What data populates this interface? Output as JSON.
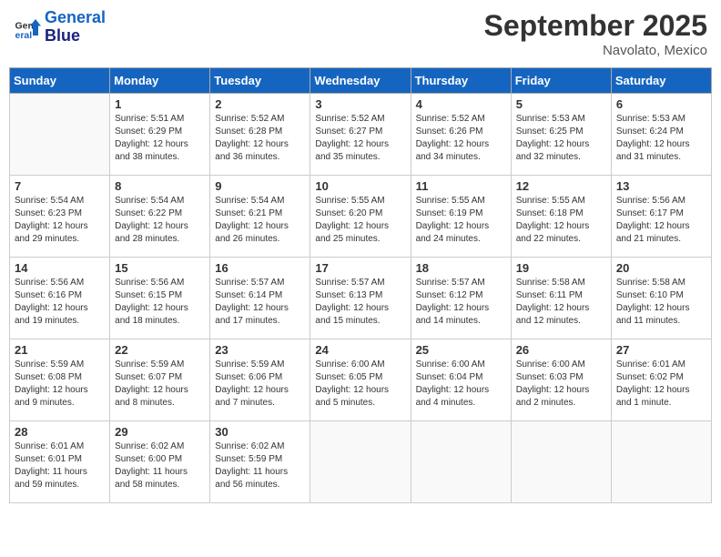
{
  "header": {
    "logo_line1": "General",
    "logo_line2": "Blue",
    "month": "September 2025",
    "location": "Navolato, Mexico"
  },
  "days_of_week": [
    "Sunday",
    "Monday",
    "Tuesday",
    "Wednesday",
    "Thursday",
    "Friday",
    "Saturday"
  ],
  "weeks": [
    [
      {
        "day": "",
        "info": ""
      },
      {
        "day": "1",
        "info": "Sunrise: 5:51 AM\nSunset: 6:29 PM\nDaylight: 12 hours\nand 38 minutes."
      },
      {
        "day": "2",
        "info": "Sunrise: 5:52 AM\nSunset: 6:28 PM\nDaylight: 12 hours\nand 36 minutes."
      },
      {
        "day": "3",
        "info": "Sunrise: 5:52 AM\nSunset: 6:27 PM\nDaylight: 12 hours\nand 35 minutes."
      },
      {
        "day": "4",
        "info": "Sunrise: 5:52 AM\nSunset: 6:26 PM\nDaylight: 12 hours\nand 34 minutes."
      },
      {
        "day": "5",
        "info": "Sunrise: 5:53 AM\nSunset: 6:25 PM\nDaylight: 12 hours\nand 32 minutes."
      },
      {
        "day": "6",
        "info": "Sunrise: 5:53 AM\nSunset: 6:24 PM\nDaylight: 12 hours\nand 31 minutes."
      }
    ],
    [
      {
        "day": "7",
        "info": "Sunrise: 5:54 AM\nSunset: 6:23 PM\nDaylight: 12 hours\nand 29 minutes."
      },
      {
        "day": "8",
        "info": "Sunrise: 5:54 AM\nSunset: 6:22 PM\nDaylight: 12 hours\nand 28 minutes."
      },
      {
        "day": "9",
        "info": "Sunrise: 5:54 AM\nSunset: 6:21 PM\nDaylight: 12 hours\nand 26 minutes."
      },
      {
        "day": "10",
        "info": "Sunrise: 5:55 AM\nSunset: 6:20 PM\nDaylight: 12 hours\nand 25 minutes."
      },
      {
        "day": "11",
        "info": "Sunrise: 5:55 AM\nSunset: 6:19 PM\nDaylight: 12 hours\nand 24 minutes."
      },
      {
        "day": "12",
        "info": "Sunrise: 5:55 AM\nSunset: 6:18 PM\nDaylight: 12 hours\nand 22 minutes."
      },
      {
        "day": "13",
        "info": "Sunrise: 5:56 AM\nSunset: 6:17 PM\nDaylight: 12 hours\nand 21 minutes."
      }
    ],
    [
      {
        "day": "14",
        "info": "Sunrise: 5:56 AM\nSunset: 6:16 PM\nDaylight: 12 hours\nand 19 minutes."
      },
      {
        "day": "15",
        "info": "Sunrise: 5:56 AM\nSunset: 6:15 PM\nDaylight: 12 hours\nand 18 minutes."
      },
      {
        "day": "16",
        "info": "Sunrise: 5:57 AM\nSunset: 6:14 PM\nDaylight: 12 hours\nand 17 minutes."
      },
      {
        "day": "17",
        "info": "Sunrise: 5:57 AM\nSunset: 6:13 PM\nDaylight: 12 hours\nand 15 minutes."
      },
      {
        "day": "18",
        "info": "Sunrise: 5:57 AM\nSunset: 6:12 PM\nDaylight: 12 hours\nand 14 minutes."
      },
      {
        "day": "19",
        "info": "Sunrise: 5:58 AM\nSunset: 6:11 PM\nDaylight: 12 hours\nand 12 minutes."
      },
      {
        "day": "20",
        "info": "Sunrise: 5:58 AM\nSunset: 6:10 PM\nDaylight: 12 hours\nand 11 minutes."
      }
    ],
    [
      {
        "day": "21",
        "info": "Sunrise: 5:59 AM\nSunset: 6:08 PM\nDaylight: 12 hours\nand 9 minutes."
      },
      {
        "day": "22",
        "info": "Sunrise: 5:59 AM\nSunset: 6:07 PM\nDaylight: 12 hours\nand 8 minutes."
      },
      {
        "day": "23",
        "info": "Sunrise: 5:59 AM\nSunset: 6:06 PM\nDaylight: 12 hours\nand 7 minutes."
      },
      {
        "day": "24",
        "info": "Sunrise: 6:00 AM\nSunset: 6:05 PM\nDaylight: 12 hours\nand 5 minutes."
      },
      {
        "day": "25",
        "info": "Sunrise: 6:00 AM\nSunset: 6:04 PM\nDaylight: 12 hours\nand 4 minutes."
      },
      {
        "day": "26",
        "info": "Sunrise: 6:00 AM\nSunset: 6:03 PM\nDaylight: 12 hours\nand 2 minutes."
      },
      {
        "day": "27",
        "info": "Sunrise: 6:01 AM\nSunset: 6:02 PM\nDaylight: 12 hours\nand 1 minute."
      }
    ],
    [
      {
        "day": "28",
        "info": "Sunrise: 6:01 AM\nSunset: 6:01 PM\nDaylight: 11 hours\nand 59 minutes."
      },
      {
        "day": "29",
        "info": "Sunrise: 6:02 AM\nSunset: 6:00 PM\nDaylight: 11 hours\nand 58 minutes."
      },
      {
        "day": "30",
        "info": "Sunrise: 6:02 AM\nSunset: 5:59 PM\nDaylight: 11 hours\nand 56 minutes."
      },
      {
        "day": "",
        "info": ""
      },
      {
        "day": "",
        "info": ""
      },
      {
        "day": "",
        "info": ""
      },
      {
        "day": "",
        "info": ""
      }
    ]
  ]
}
